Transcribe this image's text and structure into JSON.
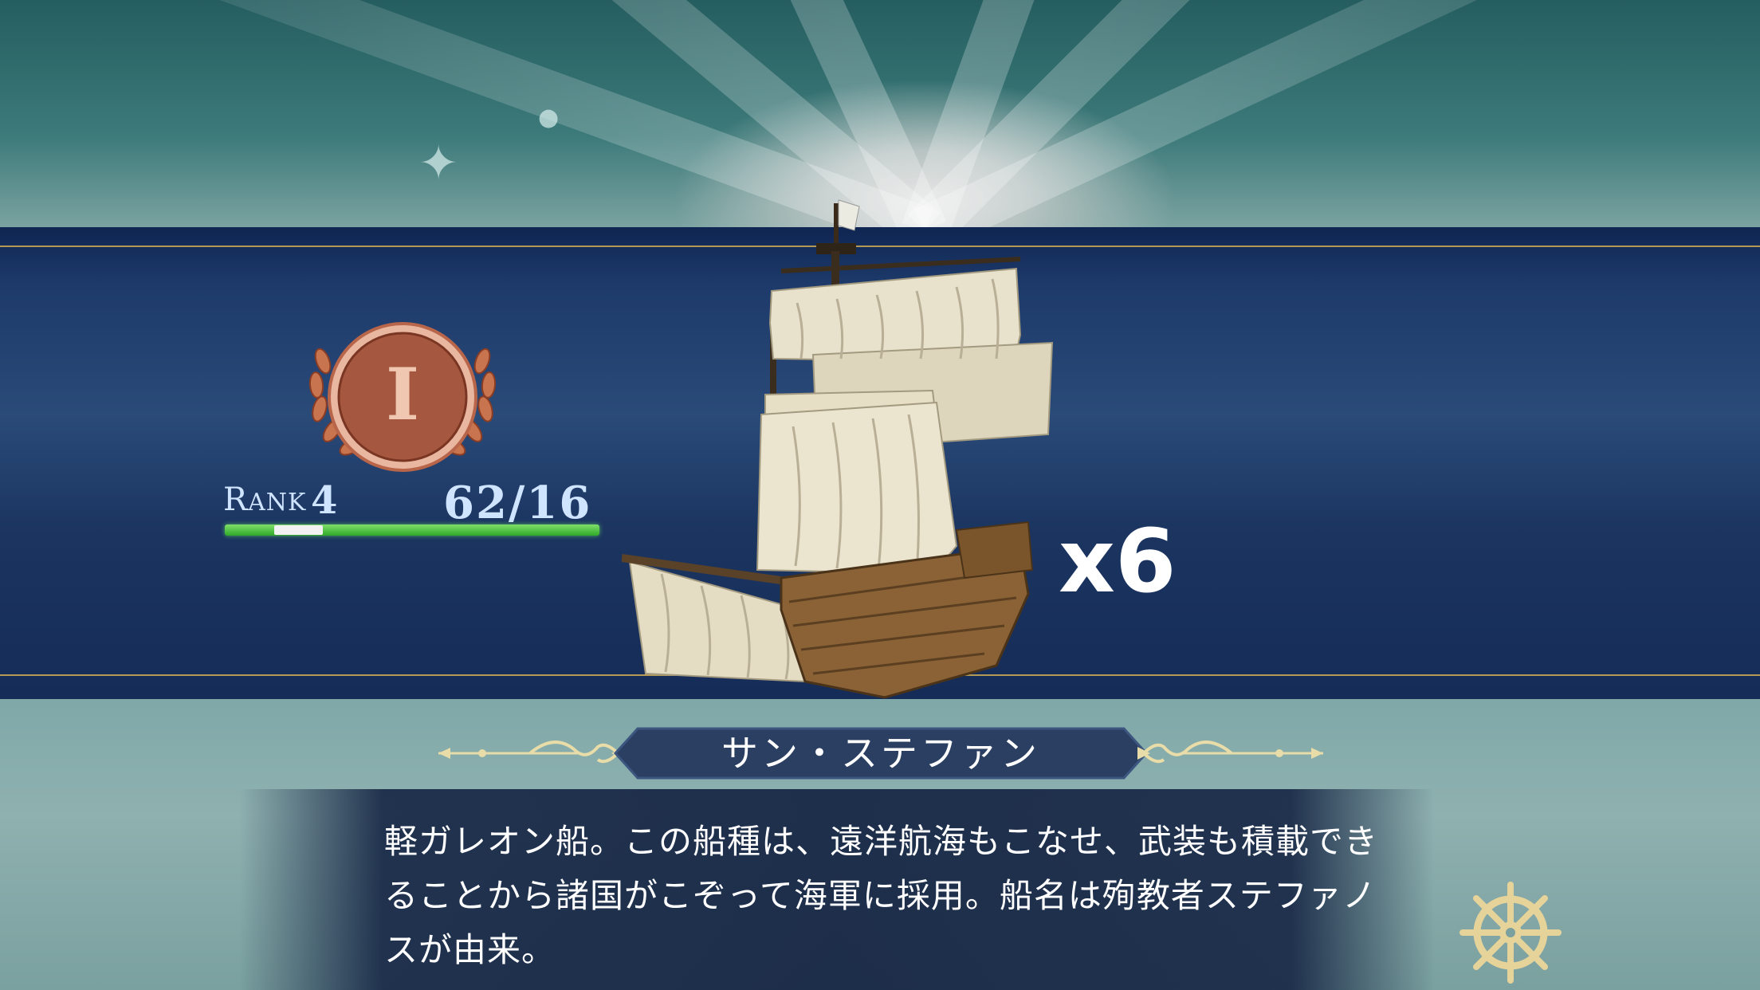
{
  "rank": {
    "medal_numeral": "I",
    "label_first": "R",
    "label_rest": "ANK",
    "value": "4",
    "exp_text": "62/16",
    "exp_progress": 0.13
  },
  "ship": {
    "count": "x6",
    "name": "サン・ステファン",
    "description": "軽ガレオン船。この船種は、遠洋航海もこなせ、武装も積載できることから諸国がこぞって海軍に採用。船名は殉教者ステファノスが由来。"
  },
  "colors": {
    "band": "#1d3a6a",
    "gold_line": "#b59a55",
    "medal": "#a5583f",
    "exp_bar": "#3fbf35"
  },
  "icons": [
    "laurel-medal-icon",
    "ship-wheel-icon",
    "ornament-icon"
  ]
}
